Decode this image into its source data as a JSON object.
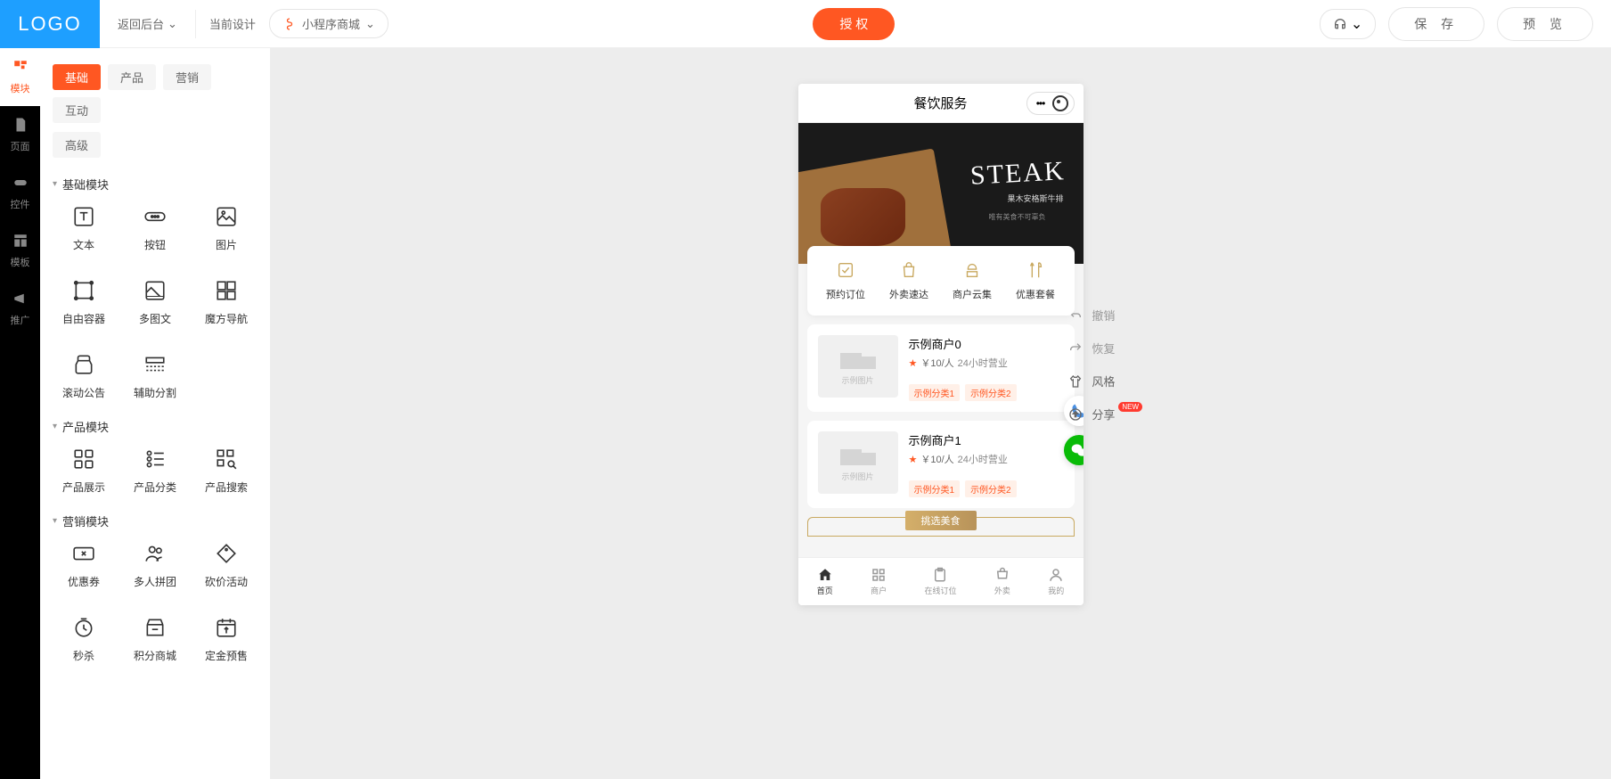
{
  "header": {
    "logo": "LOGO",
    "back": "返回后台",
    "current": "当前设计",
    "selector": "小程序商城",
    "auth": "授 权",
    "save": "保 存",
    "preview": "预 览"
  },
  "rail": {
    "module": "模块",
    "page": "页面",
    "widget": "控件",
    "template": "模板",
    "promote": "推广"
  },
  "tabs": {
    "basic": "基础",
    "product": "产品",
    "marketing": "营销",
    "interactive": "互动",
    "advanced": "高级"
  },
  "sections": {
    "basic": "基础模块",
    "product": "产品模块",
    "marketing": "营销模块"
  },
  "modules": {
    "text": "文本",
    "button": "按钮",
    "image": "图片",
    "container": "自由容器",
    "multiimg": "多图文",
    "magicnav": "魔方导航",
    "scroll": "滚动公告",
    "divider": "辅助分割",
    "productshow": "产品展示",
    "productcat": "产品分类",
    "productsearch": "产品搜索",
    "coupon": "优惠券",
    "groupbuy": "多人拼团",
    "bargain": "砍价活动",
    "seckill": "秒杀",
    "points": "积分商城",
    "presale": "定金预售"
  },
  "phone": {
    "title": "餐饮服务",
    "banner_title": "STEAK",
    "banner_sub": "果木安格斯牛排",
    "banner_sub2": "唯有美食不可辜负",
    "features": {
      "booking": "预约订位",
      "delivery": "外卖速达",
      "merchants": "商户云集",
      "combo": "优惠套餐"
    },
    "merchants": [
      {
        "name": "示例商户0",
        "price": "￥10/人",
        "hours": "24小时营业",
        "tag1": "示例分类1",
        "tag2": "示例分类2",
        "img": "示例图片"
      },
      {
        "name": "示例商户1",
        "price": "￥10/人",
        "hours": "24小时营业",
        "tag1": "示例分类1",
        "tag2": "示例分类2",
        "img": "示例图片"
      }
    ],
    "section_title": "挑选美食",
    "tabbar": {
      "home": "首页",
      "merchant": "商户",
      "booking": "在线订位",
      "delivery": "外卖",
      "mine": "我的"
    }
  },
  "tools": {
    "undo": "撤销",
    "redo": "恢复",
    "style": "风格",
    "share": "分享",
    "new": "NEW"
  }
}
